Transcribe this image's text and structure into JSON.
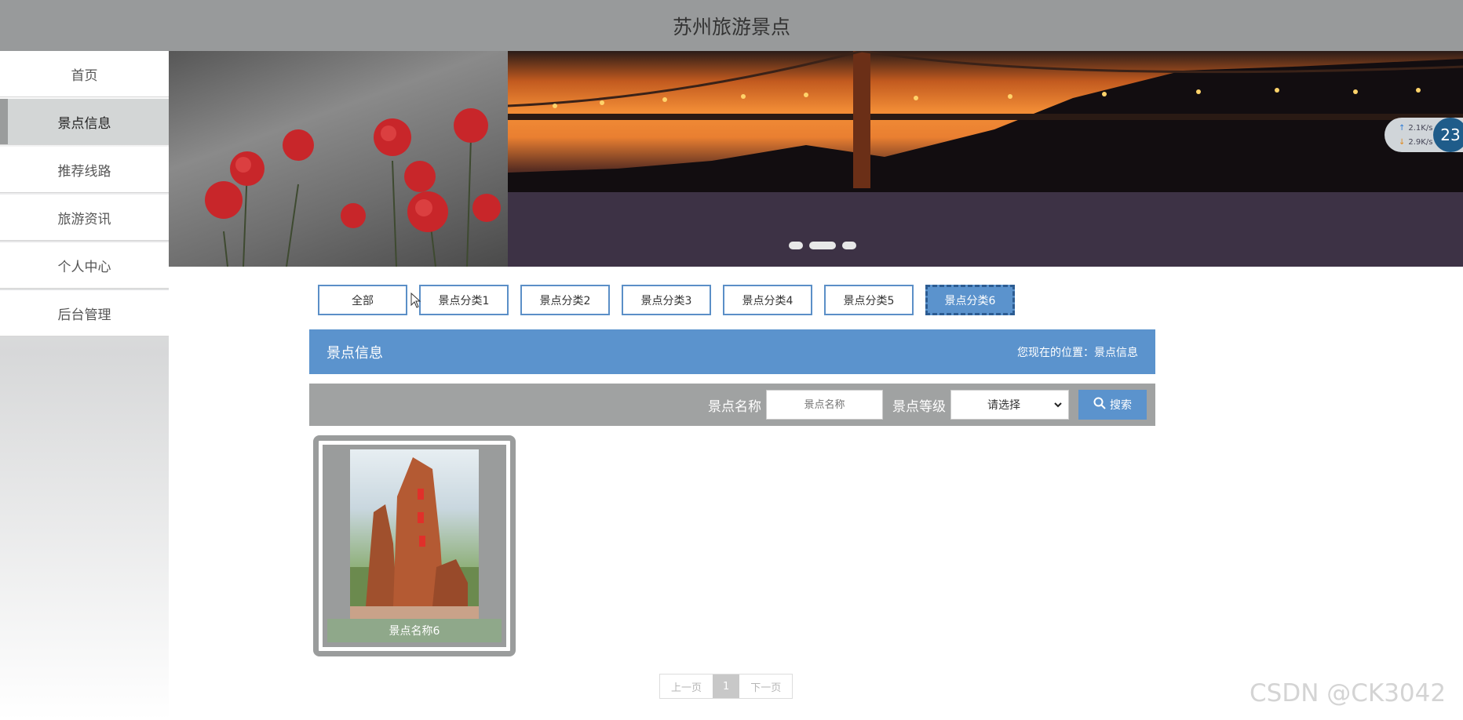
{
  "header": {
    "title": "苏州旅游景点"
  },
  "sidebar": {
    "items": [
      {
        "label": "首页"
      },
      {
        "label": "景点信息"
      },
      {
        "label": "推荐线路"
      },
      {
        "label": "旅游资讯"
      },
      {
        "label": "个人中心"
      },
      {
        "label": "后台管理"
      }
    ],
    "active_index": 1
  },
  "net_widget": {
    "upload": "2.1K/s",
    "download": "2.9K/s",
    "badge": "23"
  },
  "tabs": [
    {
      "label": "全部"
    },
    {
      "label": "景点分类1"
    },
    {
      "label": "景点分类2"
    },
    {
      "label": "景点分类3"
    },
    {
      "label": "景点分类4"
    },
    {
      "label": "景点分类5"
    },
    {
      "label": "景点分类6"
    }
  ],
  "section": {
    "title": "景点信息",
    "location": "您现在的位置：景点信息"
  },
  "search": {
    "name_label": "景点名称",
    "name_placeholder": "景点名称",
    "level_label": "景点等级",
    "level_selected": "请选择",
    "button_label": "搜索"
  },
  "cards": [
    {
      "name": "景点名称6"
    }
  ],
  "pager": {
    "prev": "上一页",
    "current": "1",
    "next": "下一页"
  },
  "watermark": "CSDN @CK3042",
  "colors": {
    "accent": "#5b93cd",
    "header": "#989a9b",
    "panel_gray": "#a0a2a2"
  }
}
